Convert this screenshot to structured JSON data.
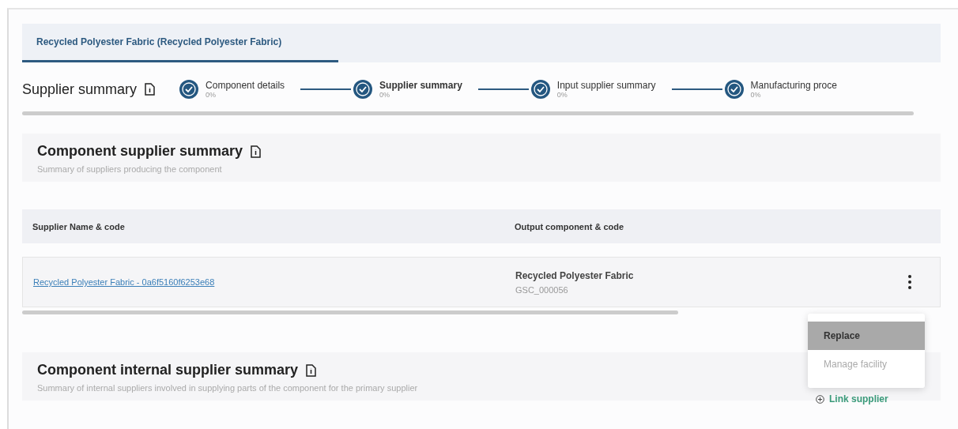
{
  "tab": {
    "label": "Recycled Polyester Fabric (Recycled Polyester Fabric)",
    "selected": true
  },
  "stepper": {
    "title": "Supplier summary",
    "steps": [
      {
        "label": "Component details",
        "percent": "0%",
        "selected": false,
        "done": true
      },
      {
        "label": "Supplier summary",
        "percent": "0%",
        "selected": true,
        "done": true
      },
      {
        "label": "Input supplier summary",
        "percent": "0%",
        "selected": false,
        "done": true
      },
      {
        "label": "Manufacturing proce",
        "percent": "0%",
        "selected": false,
        "done": true
      }
    ]
  },
  "supplier_section": {
    "title": "Component supplier summary",
    "subtitle": "Summary of suppliers producing the component"
  },
  "table": {
    "columns": [
      "Supplier Name & code",
      "Output component & code"
    ],
    "rows": [
      {
        "supplier": "Recycled Polyester Fabric - 0a6f5160f6253e68",
        "component": "Recycled Polyester Fabric",
        "code": "GSC_000056"
      }
    ]
  },
  "menu": {
    "items": [
      {
        "label": "Replace",
        "selected": true,
        "disabled": false
      },
      {
        "label": "Manage facility",
        "selected": false,
        "disabled": true
      }
    ]
  },
  "internal_section": {
    "title": "Component internal supplier summary",
    "subtitle": "Summary of internal suppliers involved in supplying parts of the component for the primary supplier",
    "action": "Link supplier"
  }
}
